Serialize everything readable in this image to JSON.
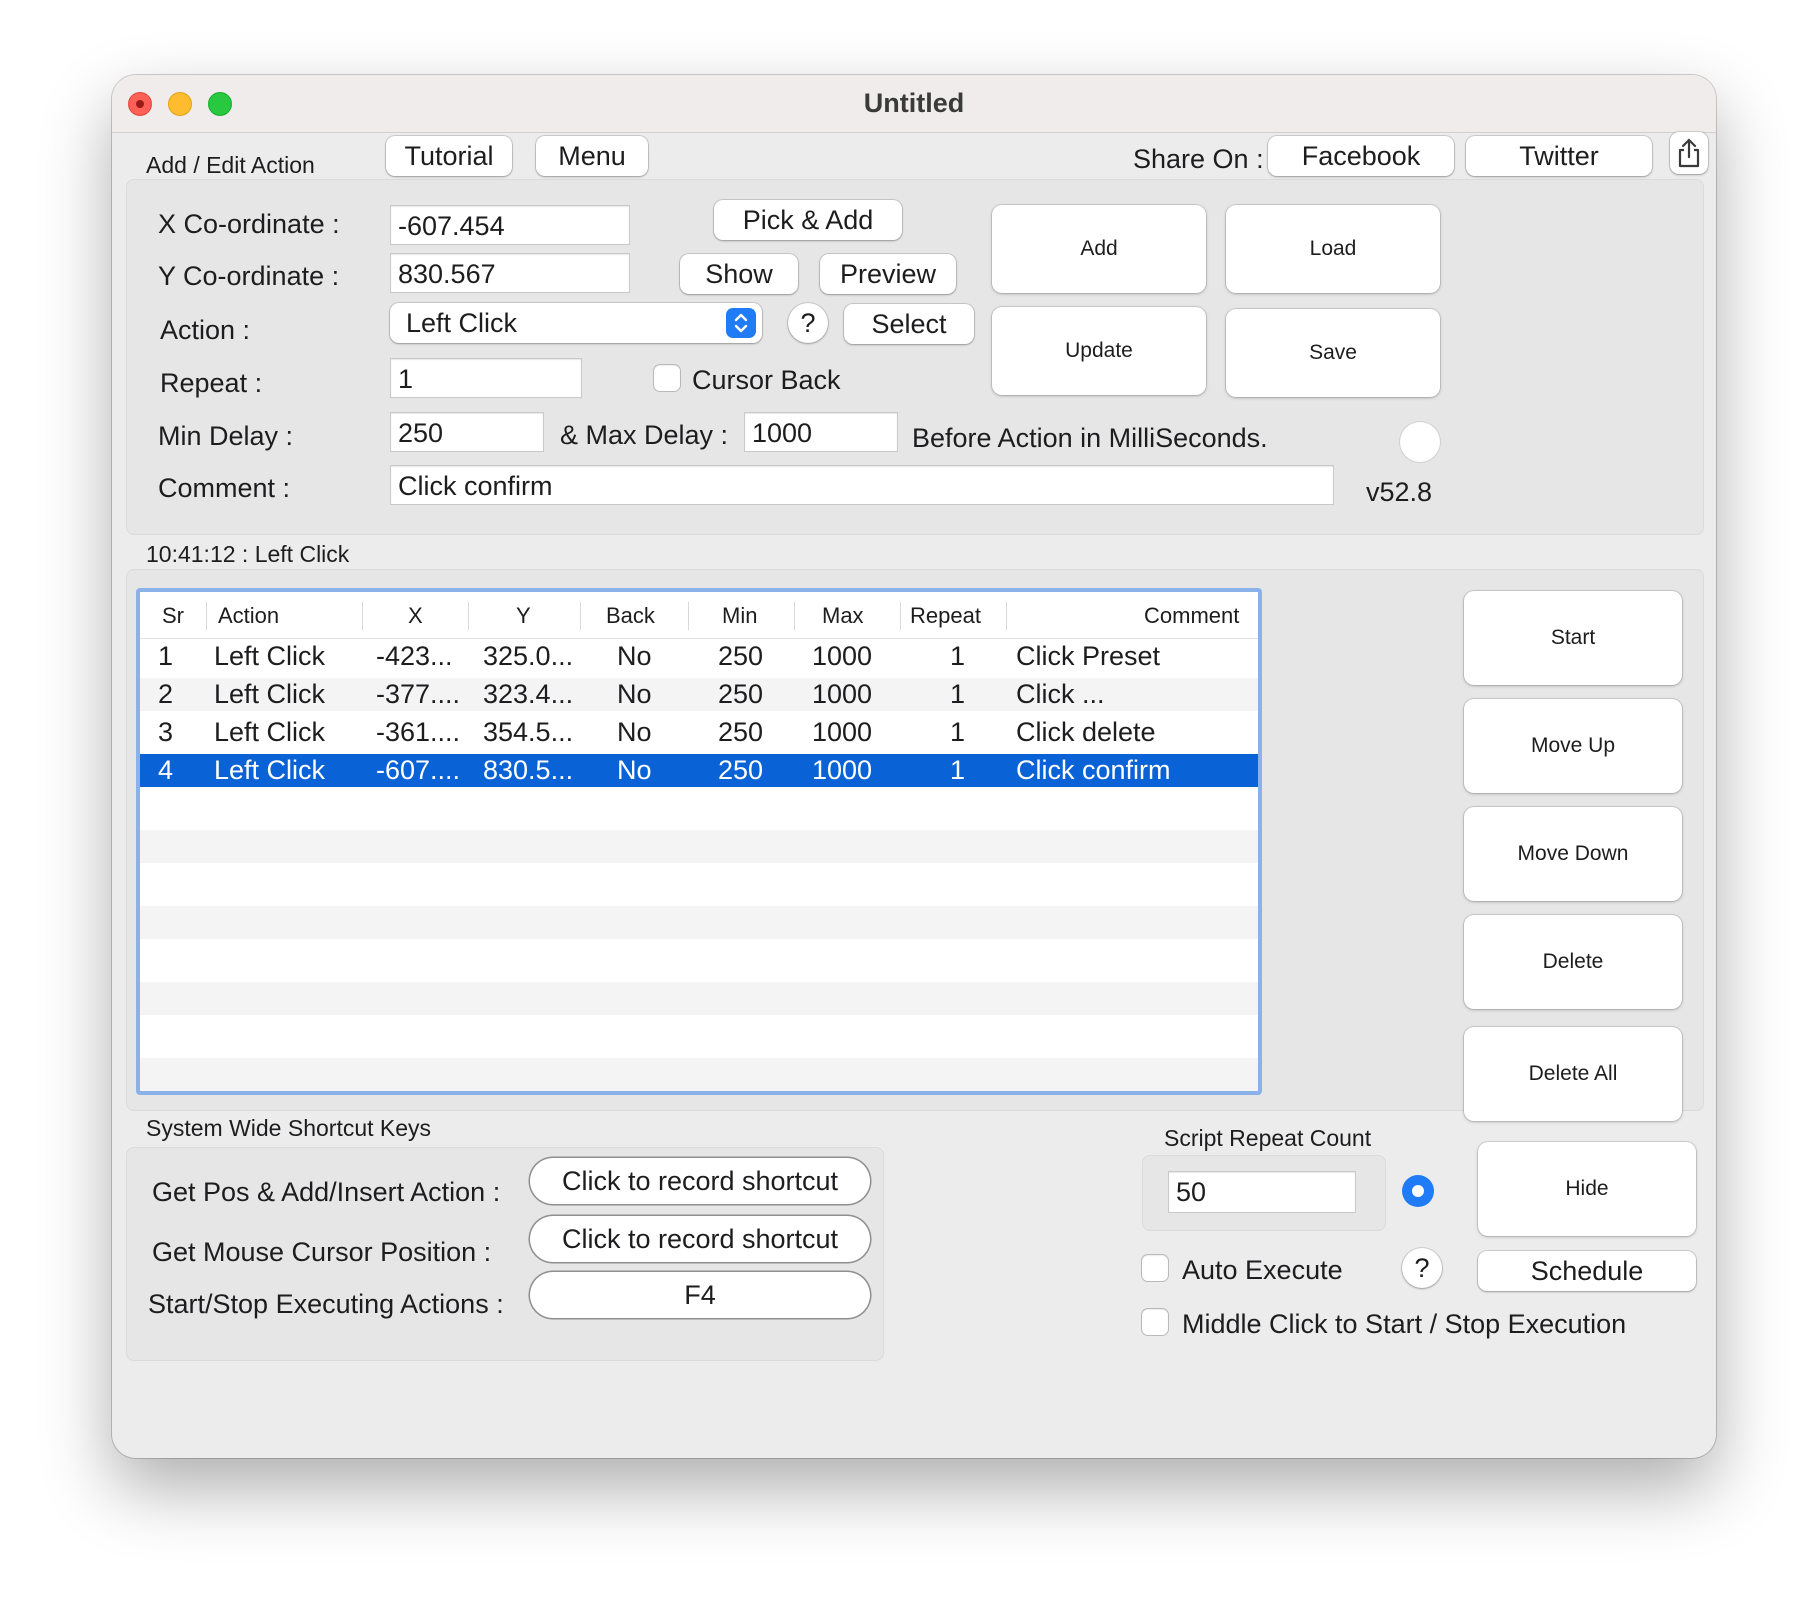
{
  "window": {
    "title": "Untitled"
  },
  "topbar": {
    "section_label": "Add / Edit Action",
    "tutorial": "Tutorial",
    "menu": "Menu",
    "share_on": "Share On :",
    "facebook": "Facebook",
    "twitter": "Twitter"
  },
  "form": {
    "x_label": "X Co-ordinate :",
    "x_value": "-607.454",
    "y_label": "Y Co-ordinate :",
    "y_value": "830.567",
    "action_label": "Action :",
    "action_value": "Left Click",
    "repeat_label": "Repeat :",
    "repeat_value": "1",
    "cursor_back": "Cursor Back",
    "min_delay_label": "Min Delay :",
    "min_delay_value": "250",
    "max_delay_label": "& Max Delay :",
    "max_delay_value": "1000",
    "delay_note": "Before Action in MilliSeconds.",
    "comment_label": "Comment :",
    "comment_value": "Click confirm",
    "version": "v52.8",
    "pick_add": "Pick & Add",
    "show": "Show",
    "preview": "Preview",
    "help": "?",
    "select": "Select",
    "add": "Add",
    "load": "Load",
    "update": "Update",
    "save": "Save"
  },
  "status": "10:41:12 : Left Click",
  "table": {
    "columns": [
      "Sr",
      "Action",
      "X",
      "Y",
      "Back",
      "Min",
      "Max",
      "Repeat",
      "Comment"
    ],
    "rows": [
      [
        "1",
        "Left Click",
        "-423...",
        "325.0...",
        "No",
        "250",
        "1000",
        "1",
        "Click Preset"
      ],
      [
        "2",
        "Left Click",
        "-377....",
        "323.4...",
        "No",
        "250",
        "1000",
        "1",
        "Click ..."
      ],
      [
        "3",
        "Left Click",
        "-361....",
        "354.5...",
        "No",
        "250",
        "1000",
        "1",
        "Click delete"
      ],
      [
        "4",
        "Left Click",
        "-607....",
        "830.5...",
        "No",
        "250",
        "1000",
        "1",
        "Click confirm"
      ]
    ],
    "selected_row": 4
  },
  "side_buttons": {
    "start": "Start",
    "move_up": "Move Up",
    "move_down": "Move Down",
    "delete": "Delete",
    "delete_all": "Delete All"
  },
  "shortcuts": {
    "title": "System Wide Shortcut Keys",
    "get_pos_label": "Get Pos & Add/Insert Action :",
    "get_pos_value": "Click to record shortcut",
    "get_mouse_label": "Get Mouse Cursor Position :",
    "get_mouse_value": "Click to record shortcut",
    "start_stop_label": "Start/Stop Executing Actions :",
    "start_stop_value": "F4"
  },
  "script": {
    "repeat_count_label": "Script Repeat Count",
    "repeat_count_value": "50",
    "hide": "Hide",
    "auto_execute": "Auto Execute",
    "help": "?",
    "schedule": "Schedule",
    "middle_click": "Middle Click to Start / Stop Execution"
  },
  "colors": {
    "selection": "#0a63d6",
    "accent": "#1f7cf6",
    "focus_ring": "#8bb1ea"
  }
}
